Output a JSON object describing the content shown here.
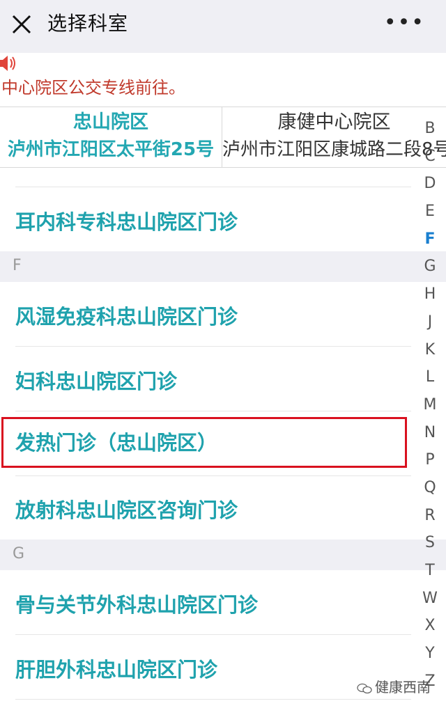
{
  "header": {
    "title": "选择科室",
    "more": "•••"
  },
  "notice": {
    "text": "中心院区公交专线前往。"
  },
  "campuses": [
    {
      "name": "忠山院区",
      "address": "泸州市江阳区太平街25号",
      "selected": true
    },
    {
      "name": "康健中心院区",
      "address": "泸州市江阳区康城路二段8号",
      "selected": false
    }
  ],
  "departments": {
    "E": [
      "耳内科专科忠山院区门诊"
    ],
    "F_header": "F",
    "F": [
      "风湿免疫科忠山院区门诊",
      "妇科忠山院区门诊",
      "发热门诊（忠山院区）",
      "放射科忠山院区咨询门诊"
    ],
    "G_header": "G",
    "G": [
      "骨与关节外科忠山院区门诊",
      "肝胆外科忠山院区门诊"
    ]
  },
  "index_bar": {
    "letters": [
      "B",
      "C",
      "D",
      "E",
      "F",
      "G",
      "H",
      "J",
      "K",
      "L",
      "M",
      "N",
      "P",
      "Q",
      "R",
      "S",
      "T",
      "W",
      "X",
      "Y",
      "Z"
    ],
    "active": "F"
  },
  "watermark": {
    "text": "健康西南"
  },
  "colors": {
    "accent": "#1fa2ad",
    "notice": "#c0392b",
    "highlight_border": "#d9111f",
    "index_active": "#1a7fcf"
  }
}
